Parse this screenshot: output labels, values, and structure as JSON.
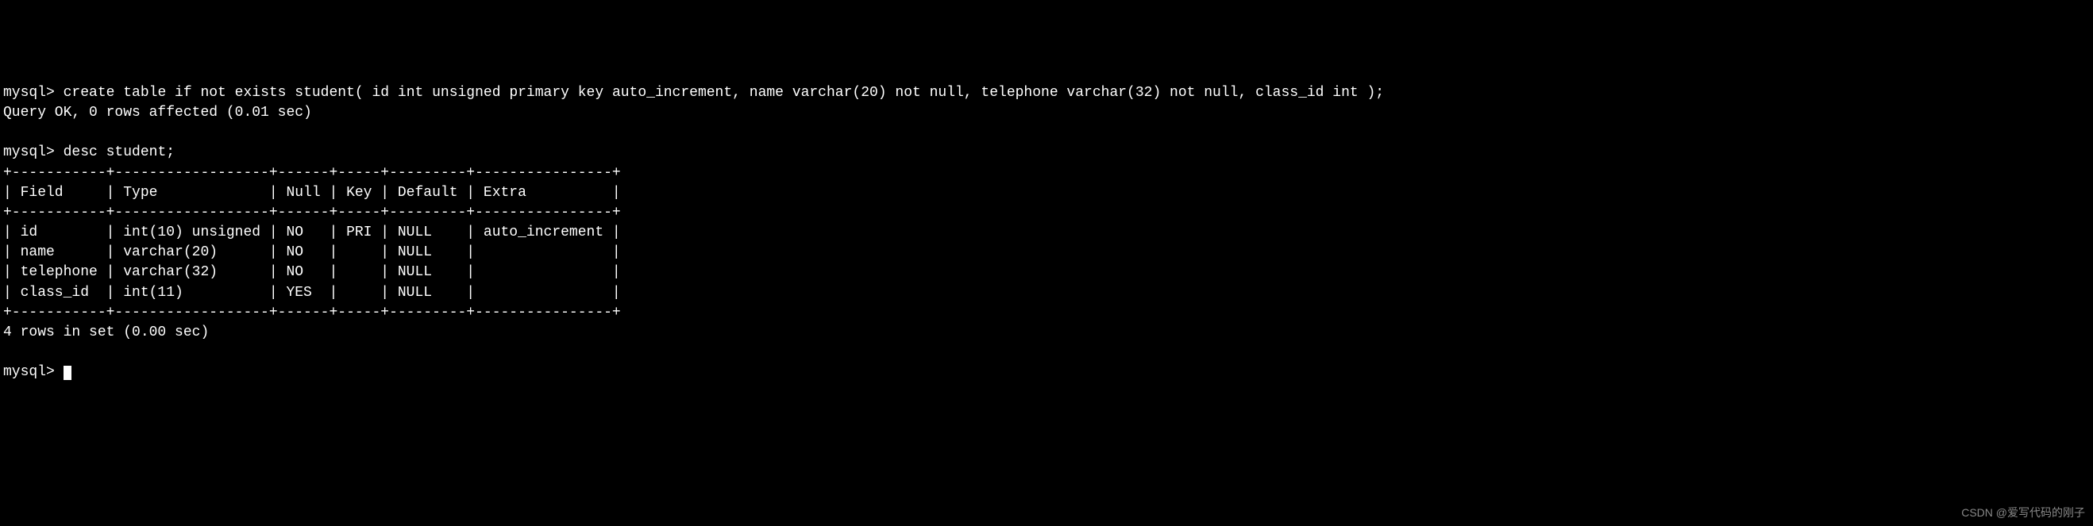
{
  "prompt": "mysql>",
  "commands": {
    "create_table": "create table if not exists student( id int unsigned primary key auto_increment, name varchar(20) not null, telephone varchar(32) not null, class_id int );",
    "create_result": "Query OK, 0 rows affected (0.01 sec)",
    "desc": "desc student;",
    "rows_result": "4 rows in set (0.00 sec)"
  },
  "table": {
    "border_top": "+-----------+------------------+------+-----+---------+----------------+",
    "header": "| Field     | Type             | Null | Key | Default | Extra          |",
    "border_mid": "+-----------+------------------+------+-----+---------+----------------+",
    "rows": [
      "| id        | int(10) unsigned | NO   | PRI | NULL    | auto_increment |",
      "| name      | varchar(20)      | NO   |     | NULL    |                |",
      "| telephone | varchar(32)      | NO   |     | NULL    |                |",
      "| class_id  | int(11)          | YES  |     | NULL    |                |"
    ],
    "border_bot": "+-----------+------------------+------+-----+---------+----------------+"
  },
  "watermark": "CSDN @爱写代码的刚子"
}
